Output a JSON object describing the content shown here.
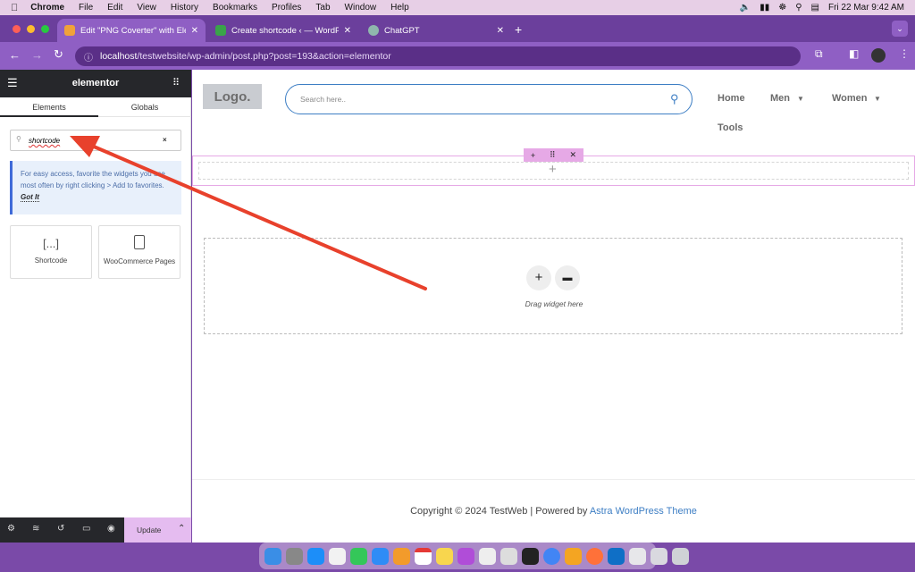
{
  "menubar": {
    "app": "Chrome",
    "items": [
      "File",
      "Edit",
      "View",
      "History",
      "Bookmarks",
      "Profiles",
      "Tab",
      "Window",
      "Help"
    ],
    "datetime": "Fri 22 Mar  9:42 AM"
  },
  "tabs": [
    {
      "label": "Edit \"PNG Coverter\" with Elem",
      "color": "#f0a23a"
    },
    {
      "label": "Create shortcode ‹ — WordPre",
      "color": "#3aa34a"
    },
    {
      "label": "ChatGPT",
      "color": "#8fb7ad"
    }
  ],
  "address": {
    "host": "localhost",
    "path": "/testwebsite/wp-admin/post.php?post=193&action=elementor"
  },
  "panel": {
    "brand": "elementor",
    "tab_elements": "Elements",
    "tab_globals": "Globals",
    "search_value": "shortcode",
    "tip_text": "For easy access, favorite the widgets you use most often by right clicking > Add to favorites.",
    "tip_link": "Got It",
    "widgets": [
      {
        "label": "Shortcode",
        "icon": "[...]"
      },
      {
        "label": "WooCommerce Pages",
        "icon": "woocommerce-pages-icon"
      }
    ],
    "update_label": "Update"
  },
  "site": {
    "logo": "Logo.",
    "search_placeholder": "Search here..",
    "nav": [
      "Home",
      "Men",
      "Women",
      "Tools"
    ],
    "drop_label": "Drag widget here",
    "copyright": "Copyright © 2024 TestWeb | Powered by ",
    "theme_link": "Astra WordPress Theme"
  },
  "colors": {
    "accent": "#e74c3c",
    "elementor_dark": "#26272b",
    "chrome_purple": "#8f5fc4"
  }
}
